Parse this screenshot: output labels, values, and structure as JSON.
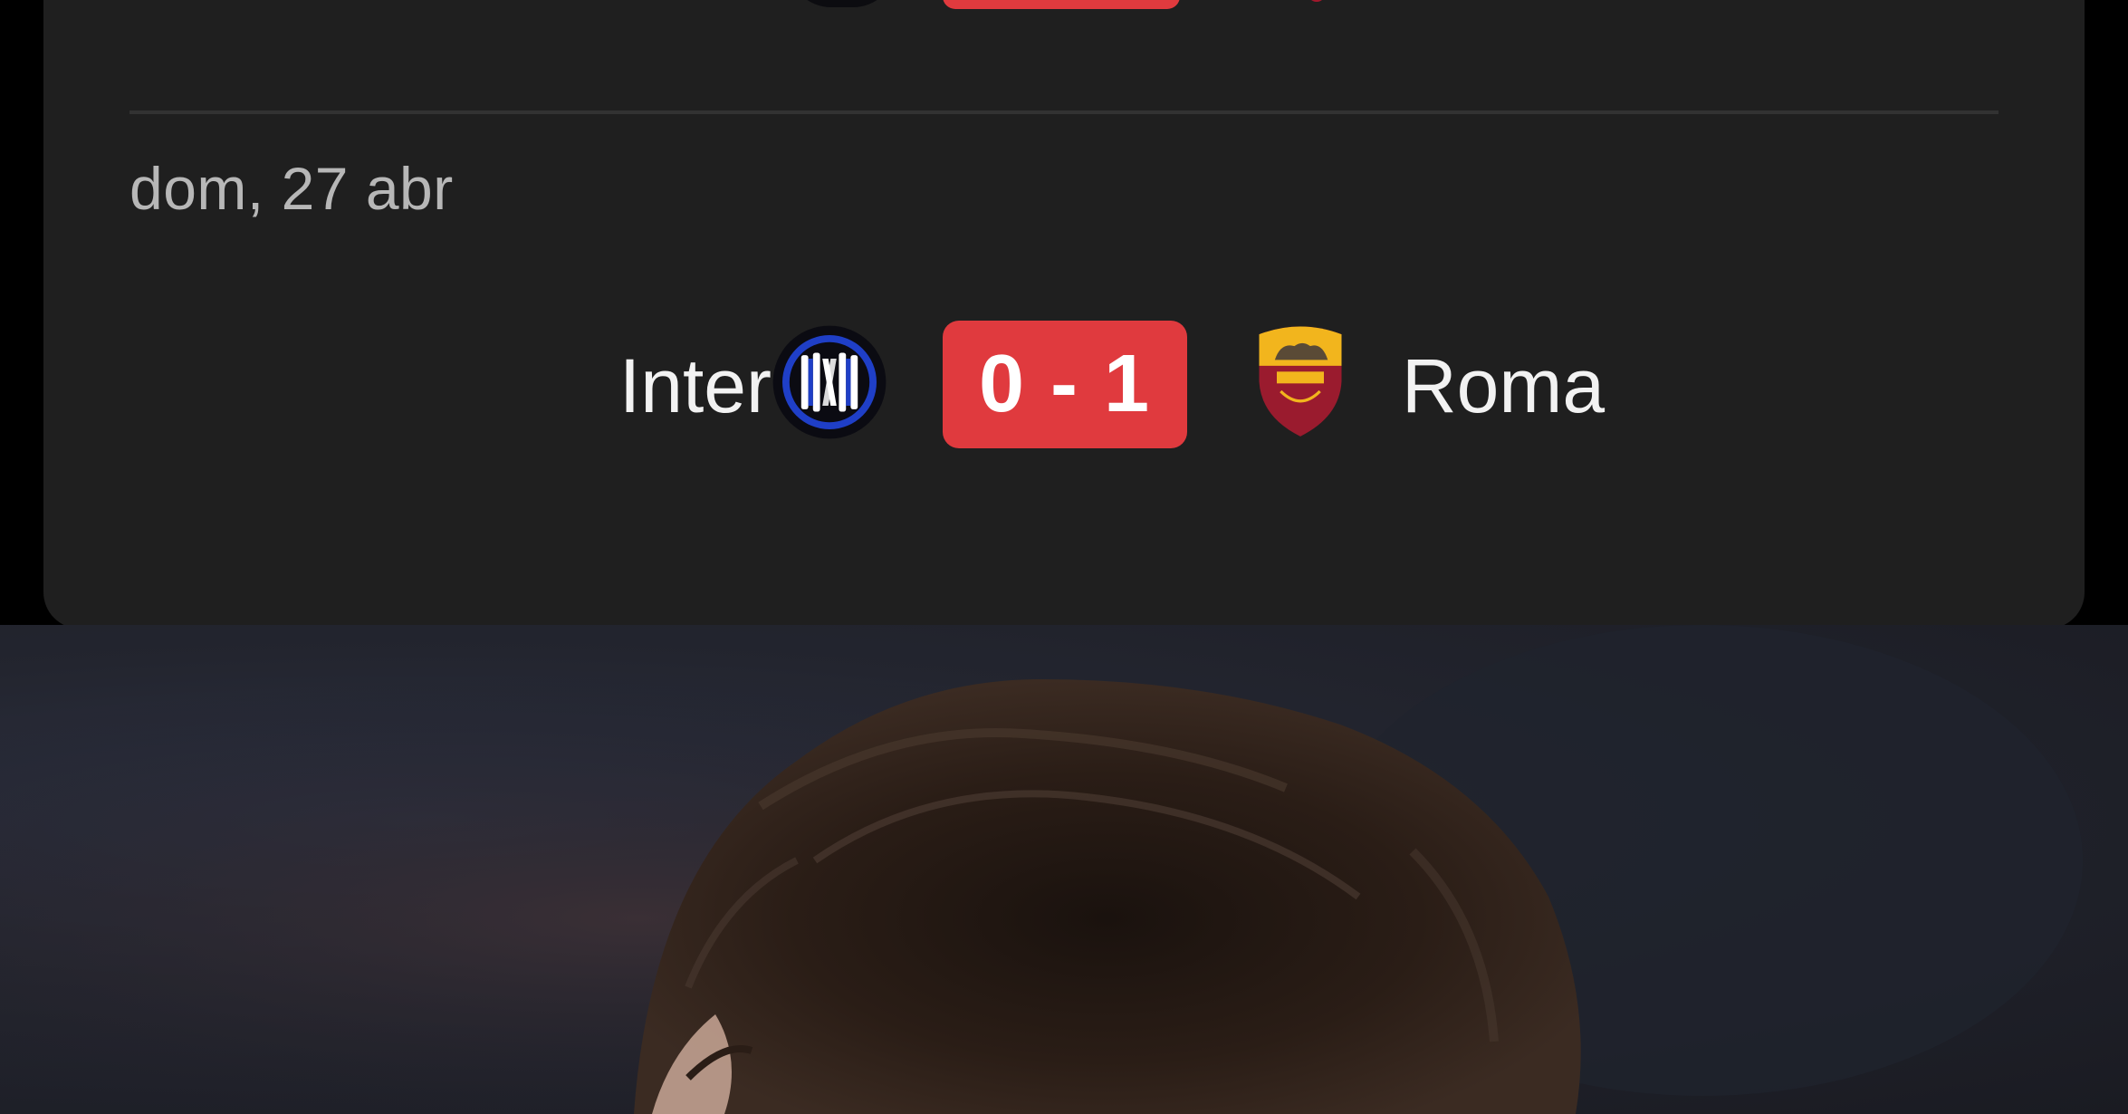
{
  "matches": [
    {
      "date": "dom, 27 abr",
      "home": {
        "name": "Inter",
        "crest_icon": "inter-crest-icon"
      },
      "score": "0 - 1",
      "away": {
        "name": "Roma",
        "crest_icon": "roma-crest-icon"
      }
    }
  ],
  "colors": {
    "card_bg": "#1f1f1f",
    "score_badge": "#e03a3e",
    "text_primary": "#f2f2f2",
    "text_secondary": "#b7b7b7"
  }
}
